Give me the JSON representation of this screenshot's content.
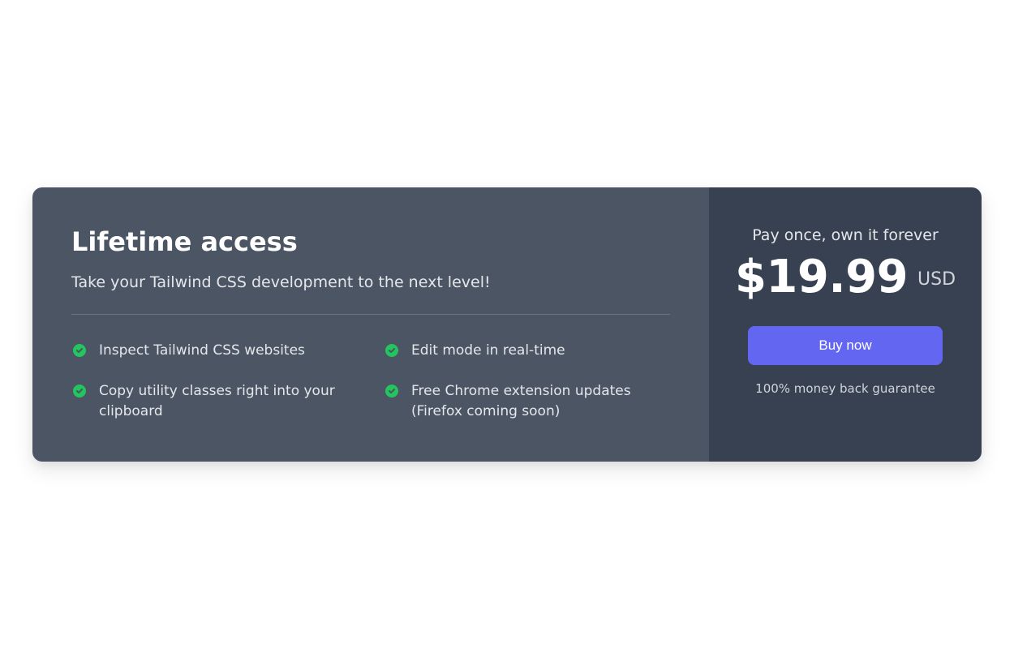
{
  "left": {
    "title": "Lifetime access",
    "subtitle": "Take your Tailwind CSS development to the next level!",
    "features": [
      "Inspect Tailwind CSS websites",
      "Edit mode in real-time",
      "Copy utility classes right into your clipboard",
      "Free Chrome extension updates (Firefox coming soon)"
    ]
  },
  "right": {
    "pay_once": "Pay once, own it forever",
    "price": "$19.99",
    "currency": "USD",
    "buy_label": "Buy now",
    "guarantee": "100% money back guarantee"
  },
  "colors": {
    "left_bg": "#4b5563",
    "right_bg": "#374151",
    "accent": "#6366f1",
    "check": "#22c55e"
  }
}
